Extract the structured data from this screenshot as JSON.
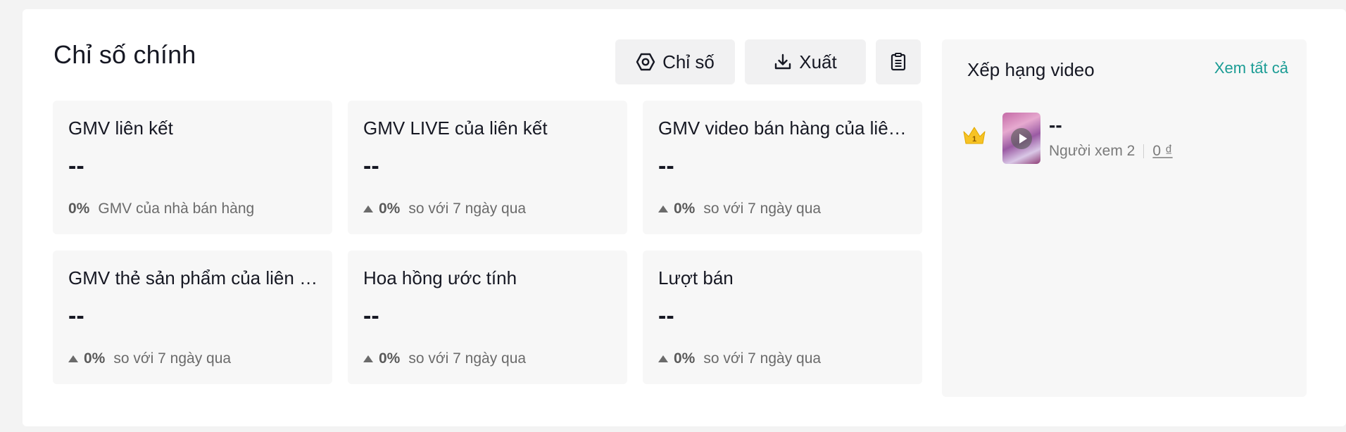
{
  "panel": {
    "title": "Chỉ số chính",
    "buttons": {
      "metrics_label": "Chỉ số",
      "export_label": "Xuất"
    },
    "cards": [
      {
        "name": "GMV liên kết",
        "value": "--",
        "change": "0%",
        "note": "GMV của nhà bán hàng"
      },
      {
        "name": "GMV LIVE của liên kết",
        "value": "--",
        "change": "0%",
        "note": "so với 7 ngày qua"
      },
      {
        "name": "GMV video bán hàng của liên kết",
        "value": "--",
        "change": "0%",
        "note": "so với 7 ngày qua"
      },
      {
        "name": "GMV thẻ sản phẩm của liên kết",
        "value": "--",
        "change": "0%",
        "note": "so với 7 ngày qua"
      },
      {
        "name": "Hoa hồng ước tính",
        "value": "--",
        "change": "0%",
        "note": "so với 7 ngày qua"
      },
      {
        "name": "Lượt bán",
        "value": "--",
        "change": "0%",
        "note": "so với 7 ngày qua"
      }
    ]
  },
  "ranking": {
    "title": "Xếp hạng video",
    "view_all": "Xem tất cả",
    "items": [
      {
        "rank": "1",
        "title": "--",
        "viewers": "Người xem 2",
        "gmv": "0 ₫"
      }
    ]
  },
  "colors": {
    "accent": "#1a9c94",
    "crown": "#f7c325",
    "card_bg": "#f7f7f7"
  },
  "icons": {
    "metrics": "hexagon-settings-icon",
    "export": "download-icon",
    "report": "clipboard-icon",
    "rank": "crown-icon"
  }
}
